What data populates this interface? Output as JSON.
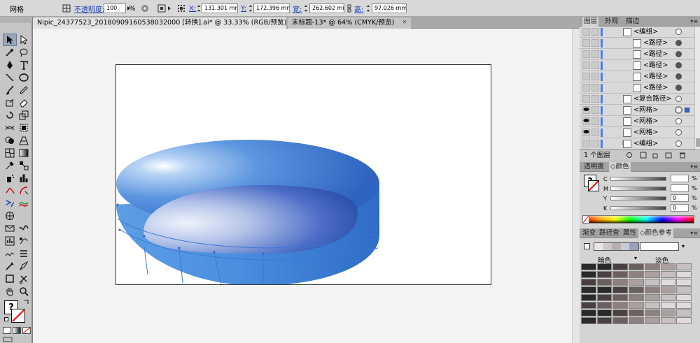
{
  "control_bar": {
    "object_type": "网格",
    "opacity_label": "不透明度:",
    "opacity_value": "100",
    "opacity_unit": "%",
    "x_label": "X:",
    "x_value": "131.301 mm",
    "y_label": "Y:",
    "y_value": "172.396 mm",
    "w_label": "宽:",
    "w_value": "262.602 mi",
    "h_label": "高:",
    "h_value": "97.026 mm"
  },
  "tabs": [
    {
      "label": "Nipic_24377523_20180909160538032000 [转换].ai* @ 33.33% (RGB/预览)",
      "close": "✕"
    },
    {
      "label": "未标题-13* @ 64% (CMYK/预览)",
      "close": "✕"
    }
  ],
  "panels": {
    "layers_tabs": [
      "图层",
      "外观",
      "描边"
    ],
    "layers": [
      {
        "name": "<编组>",
        "visible": false,
        "target": "open"
      },
      {
        "name": "<路径>",
        "visible": false,
        "target": "filled"
      },
      {
        "name": "<路径>",
        "visible": false,
        "target": "filled"
      },
      {
        "name": "<路径>",
        "visible": false,
        "target": "filled"
      },
      {
        "name": "<路径>",
        "visible": false,
        "target": "filled"
      },
      {
        "name": "<路径>",
        "visible": false,
        "target": "filled"
      },
      {
        "name": "<复合路径>",
        "visible": false,
        "target": "open"
      },
      {
        "name": "<网格>",
        "visible": true,
        "target": "selected"
      },
      {
        "name": "<网格>",
        "visible": true,
        "target": "open"
      },
      {
        "name": "<网格>",
        "visible": true,
        "target": "open"
      },
      {
        "name": "<编组>",
        "visible": false,
        "target": "open"
      }
    ],
    "layers_footer": "1 个图层",
    "color_tabs": [
      "透明度",
      "颜色"
    ],
    "cmyk": [
      {
        "channel": "C",
        "value": "",
        "pct": "%"
      },
      {
        "channel": "M",
        "value": "",
        "pct": "%"
      },
      {
        "channel": "Y",
        "value": "0",
        "pct": "%"
      },
      {
        "channel": "K",
        "value": "0",
        "pct": "%"
      }
    ],
    "guide_tabs": [
      "渐变",
      "路径查",
      "属性",
      "颜色参考"
    ],
    "guide_dark": "暗色",
    "guide_light": "淡色"
  },
  "colors": {
    "accent": "#3b62c8",
    "link": "#1a3fb0",
    "canvas_bg": "#f3f3f3"
  }
}
